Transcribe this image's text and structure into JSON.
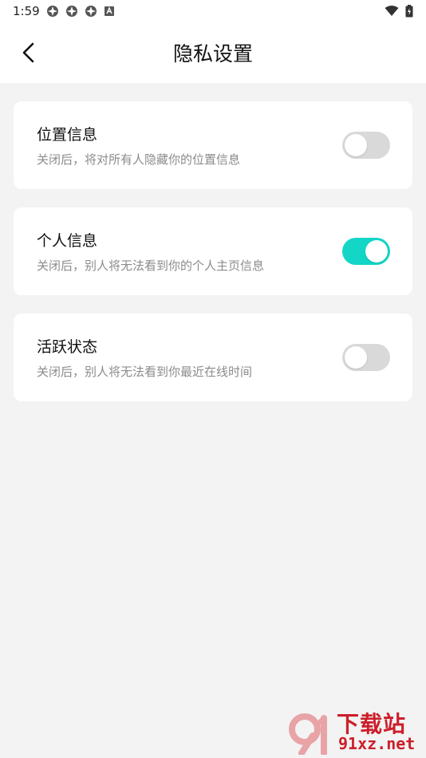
{
  "status_bar": {
    "time": "1:59",
    "left_icons": [
      "app-notification-icon",
      "app-notification-icon",
      "app-notification-icon",
      "keyboard-icon"
    ],
    "right_icons": [
      "wifi-icon",
      "battery-icon"
    ]
  },
  "header": {
    "title": "隐私设置",
    "back_icon": "chevron-left-icon"
  },
  "settings": [
    {
      "title": "位置信息",
      "description": "关闭后，将对所有人隐藏你的位置信息",
      "enabled": false
    },
    {
      "title": "个人信息",
      "description": "关闭后，别人将无法看到你的个人主页信息",
      "enabled": true
    },
    {
      "title": "活跃状态",
      "description": "关闭后，别人将无法看到你最近在线时间",
      "enabled": false
    }
  ],
  "colors": {
    "toggle_on": "#13d6c6",
    "toggle_off": "#d9d9d9",
    "background": "#f3f3f3",
    "card": "#ffffff",
    "watermark": "#cc1f2a"
  },
  "watermark": {
    "brand": "下载站",
    "domain": "91xz.net"
  }
}
